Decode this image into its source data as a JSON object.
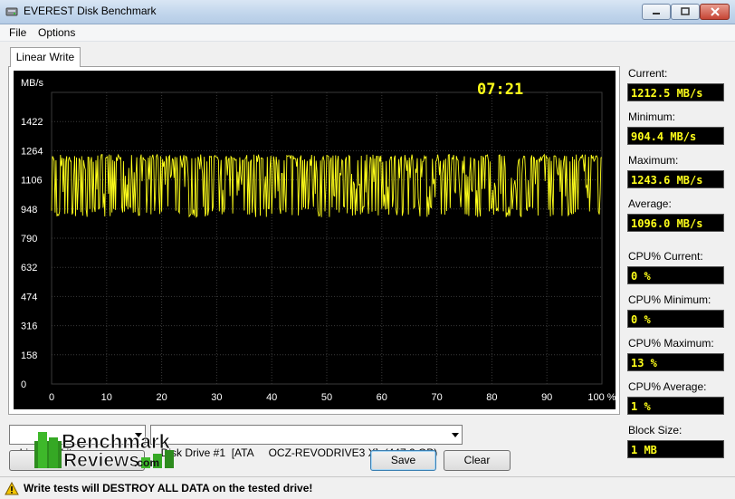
{
  "window": {
    "title": "EVEREST Disk Benchmark"
  },
  "menu": {
    "items": [
      "File",
      "Options"
    ]
  },
  "tab": {
    "label": "Linear Write"
  },
  "chart_data": {
    "type": "line",
    "title": "",
    "timer": "07:21",
    "ylabel": "MB/s",
    "xlabel": "",
    "y_ticks": [
      "1422",
      "1264",
      "1106",
      "948",
      "790",
      "632",
      "474",
      "316",
      "158",
      "0"
    ],
    "x_ticks": [
      "0",
      "10",
      "20",
      "30",
      "40",
      "50",
      "60",
      "70",
      "80",
      "90",
      "100 %"
    ],
    "xlim": [
      0,
      100
    ],
    "ylim": [
      0,
      1580
    ],
    "grid": true,
    "background": "#000000",
    "series": [
      {
        "color": "#ffff1a",
        "min": 904.4,
        "max": 1243.6,
        "average": 1096.0
      }
    ]
  },
  "stats": [
    {
      "label": "Current:",
      "value": "1212.5 MB/s"
    },
    {
      "label": "Minimum:",
      "value": "904.4 MB/s"
    },
    {
      "label": "Maximum:",
      "value": "1243.6 MB/s"
    },
    {
      "label": "Average:",
      "value": "1096.0 MB/s"
    },
    {
      "label": "CPU% Current:",
      "value": "0 %"
    },
    {
      "label": "CPU% Minimum:",
      "value": "0 %"
    },
    {
      "label": "CPU% Maximum:",
      "value": "13 %"
    },
    {
      "label": "CPU% Average:",
      "value": "1 %"
    },
    {
      "label": "Block Size:",
      "value": "1 MB"
    }
  ],
  "controls": {
    "test_select": "Linear Write",
    "drive_select": "Disk Drive #1  [ATA     OCZ-REVODRIVE3 X]  (447.2 GB)",
    "save_label": "Save",
    "clear_label": "Clear"
  },
  "logo": {
    "line1": "Benchmark",
    "line2": "Reviews",
    "suffix": ".com"
  },
  "status": {
    "warning": "Write tests will DESTROY ALL DATA on the tested drive!"
  }
}
